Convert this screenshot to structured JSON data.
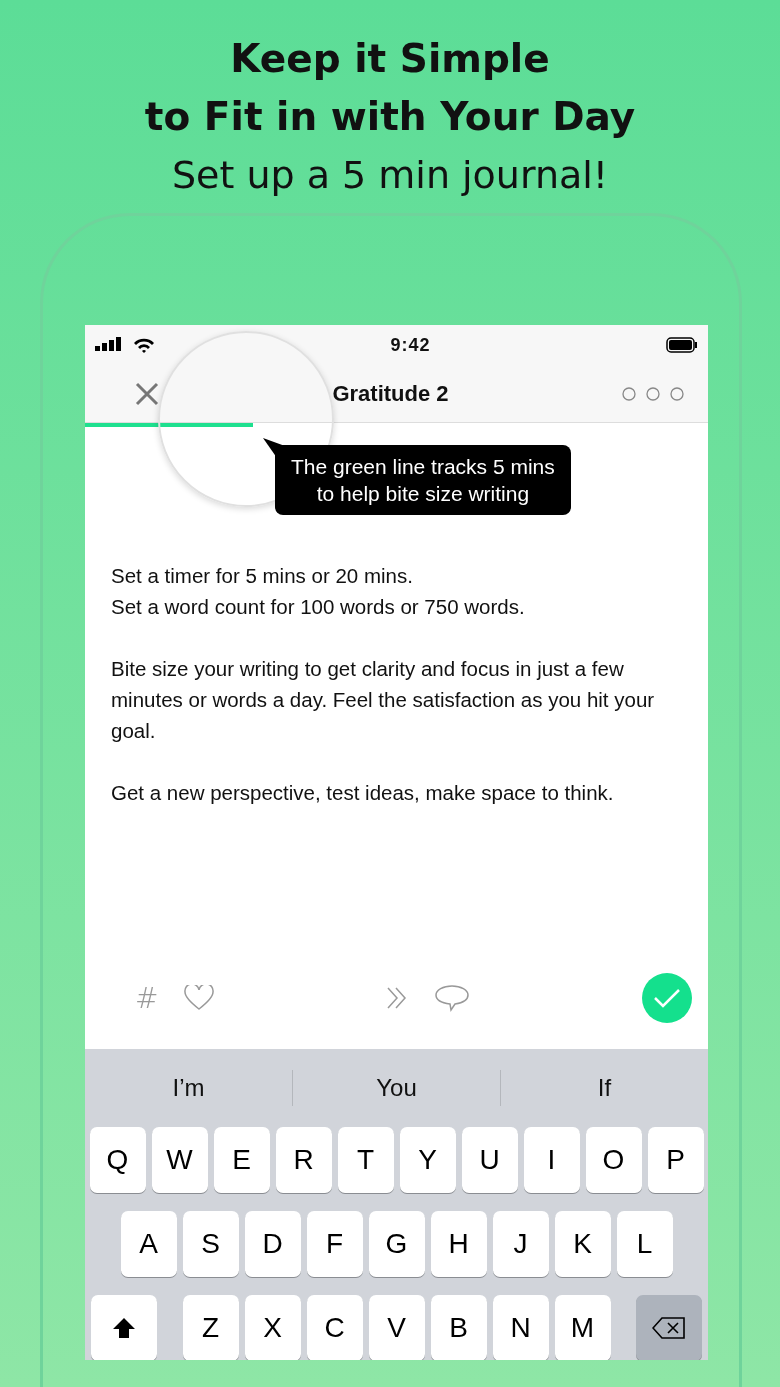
{
  "headline": {
    "lines": [
      "Keep it Simple",
      "to Fit in with Your Day"
    ],
    "subtitle": "Set up a 5 min journal!"
  },
  "status_bar": {
    "time": "9:42"
  },
  "nav": {
    "title": "Gratitude 2"
  },
  "progress": {
    "level": 0.27
  },
  "tooltip": {
    "text": "The green line tracks 5 mins\nto help bite size writing"
  },
  "paragraphs": [
    "Set a timer for 5 mins or 20 mins.\nSet a word count for 100 words or 750 words.",
    "Bite size your writing to get clarity and focus in just a few minutes or words a day. Feel the satisfaction as you hit your goal.",
    "Get a new perspective, test ideas, make space to think."
  ],
  "toolbar": {
    "hash": "#"
  },
  "suggestions": [
    "I’m",
    "You",
    "If"
  ],
  "keyboard": {
    "rows": [
      [
        "Q",
        "W",
        "E",
        "R",
        "T",
        "Y",
        "U",
        "I",
        "O",
        "P"
      ],
      [
        "A",
        "S",
        "D",
        "F",
        "G",
        "H",
        "J",
        "K",
        "L"
      ],
      [
        "Z",
        "X",
        "C",
        "V",
        "B",
        "N",
        "M"
      ]
    ]
  }
}
